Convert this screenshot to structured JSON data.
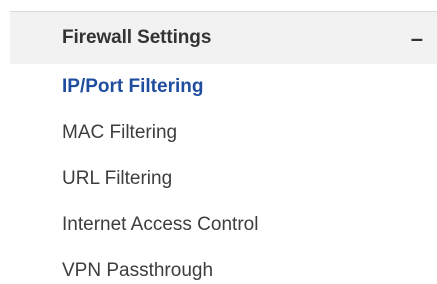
{
  "section": {
    "title": "Firewall Settings",
    "toggle_symbol": "–",
    "toggle_icon": "minus-icon"
  },
  "items": [
    {
      "label": "IP/Port Filtering",
      "active": true
    },
    {
      "label": "MAC Filtering",
      "active": false
    },
    {
      "label": "URL Filtering",
      "active": false
    },
    {
      "label": "Internet Access Control",
      "active": false
    },
    {
      "label": "VPN Passthrough",
      "active": false
    }
  ],
  "colors": {
    "active_text": "#1f4e9e",
    "text": "#3d3d3d",
    "header_bg": "#f2f2f2"
  }
}
